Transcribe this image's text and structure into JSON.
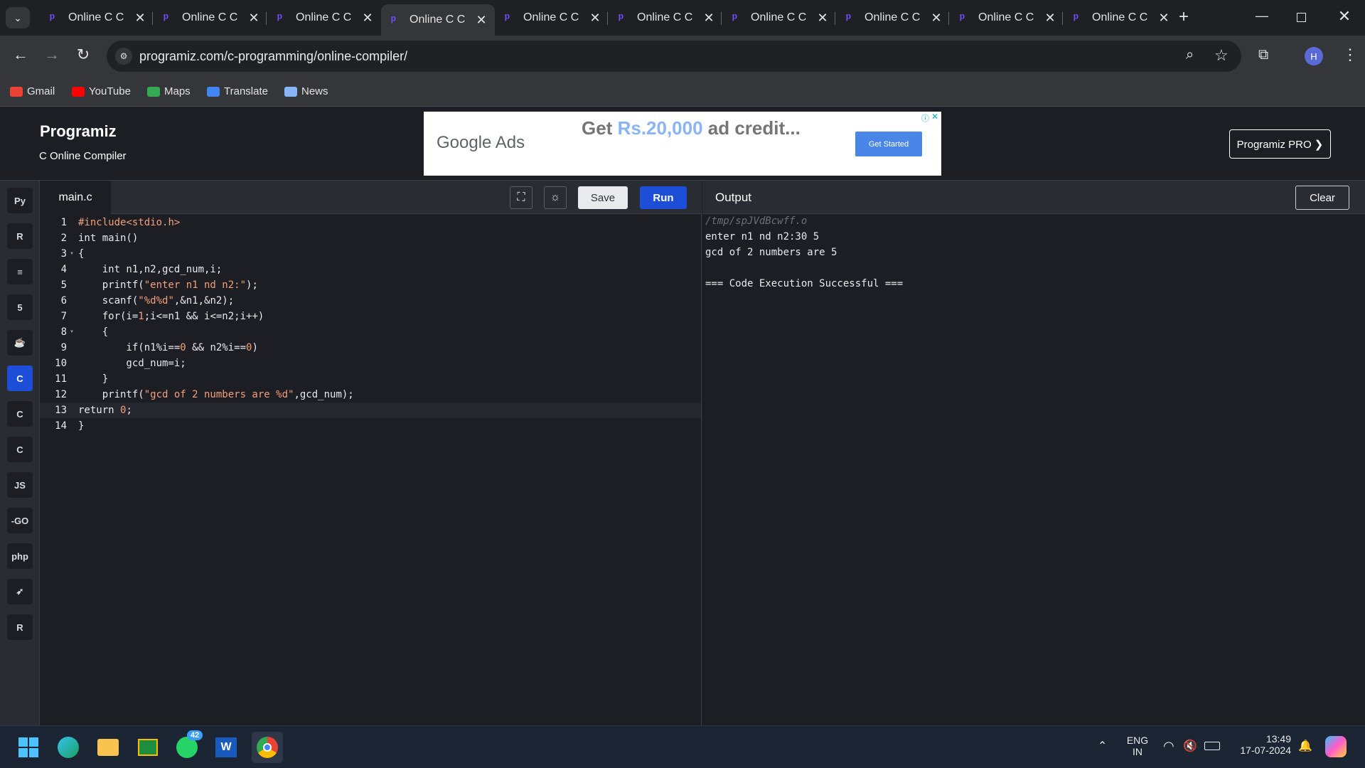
{
  "browser": {
    "tabs": [
      {
        "title": "Online C C",
        "active": false
      },
      {
        "title": "Online C C",
        "active": false
      },
      {
        "title": "Online C C",
        "active": false
      },
      {
        "title": "Online C C",
        "active": true
      },
      {
        "title": "Online C C",
        "active": false
      },
      {
        "title": "Online C C",
        "active": false
      },
      {
        "title": "Online C C",
        "active": false
      },
      {
        "title": "Online C C",
        "active": false
      },
      {
        "title": "Online C C",
        "active": false
      },
      {
        "title": "Online C C",
        "active": false
      }
    ],
    "url": "programiz.com/c-programming/online-compiler/",
    "profile_initial": "H",
    "bookmarks": [
      {
        "label": "Gmail",
        "icon": "gmail-icon",
        "color": "#ea4335"
      },
      {
        "label": "YouTube",
        "icon": "youtube-icon",
        "color": "#ff0000"
      },
      {
        "label": "Maps",
        "icon": "maps-icon",
        "color": "#34a853"
      },
      {
        "label": "Translate",
        "icon": "translate-icon",
        "color": "#4285f4"
      },
      {
        "label": "News",
        "icon": "news-icon",
        "color": "#8ab4f8"
      }
    ]
  },
  "site": {
    "logo": "Programiz",
    "subtitle": "C Online Compiler",
    "ad": {
      "brand": "Google Ads",
      "headline_prefix": "Get ",
      "headline_amount": "Rs.20,000",
      "headline_suffix": " ad credit...",
      "cta": "Get Started"
    },
    "pro_button": "Programiz PRO ❯"
  },
  "rail": {
    "items": [
      {
        "name": "python-icon",
        "glyph": "Py",
        "active": false
      },
      {
        "name": "r-icon",
        "glyph": "R",
        "active": false
      },
      {
        "name": "sql-icon",
        "glyph": "≡",
        "active": false
      },
      {
        "name": "html-icon",
        "glyph": "5",
        "active": false
      },
      {
        "name": "java-icon",
        "glyph": "☕",
        "active": false
      },
      {
        "name": "c-icon",
        "glyph": "C",
        "active": true
      },
      {
        "name": "cpp-icon",
        "glyph": "C",
        "active": false
      },
      {
        "name": "csharp-icon",
        "glyph": "C",
        "active": false
      },
      {
        "name": "js-icon",
        "glyph": "JS",
        "active": false
      },
      {
        "name": "go-icon",
        "glyph": "-GO",
        "active": false
      },
      {
        "name": "php-icon",
        "glyph": "php",
        "active": false
      },
      {
        "name": "swift-icon",
        "glyph": "➶",
        "active": false
      },
      {
        "name": "rust-icon",
        "glyph": "R",
        "active": false
      }
    ]
  },
  "editor": {
    "filename": "main.c",
    "save_label": "Save",
    "run_label": "Run",
    "lines": [
      {
        "n": "1",
        "html": "<span class=\"kw\">#include</span><span class=\"inc\">&lt;stdio.h&gt;</span>",
        "fold": ""
      },
      {
        "n": "2",
        "html": "int main()",
        "fold": ""
      },
      {
        "n": "3",
        "html": "{",
        "fold": "▾"
      },
      {
        "n": "4",
        "html": "    int n1,n2,gcd_num,i;",
        "fold": ""
      },
      {
        "n": "5",
        "html": "    printf(<span class=\"str\">\"enter n1 nd n2:\"</span>);",
        "fold": ""
      },
      {
        "n": "6",
        "html": "    scanf(<span class=\"str\">\"%d%d\"</span>,&amp;n1,&amp;n2);",
        "fold": ""
      },
      {
        "n": "7",
        "html": "    for(i=<span class=\"str\">1</span>;i&lt;=n1 &amp;&amp; i&lt;=n2;i++)",
        "fold": ""
      },
      {
        "n": "8",
        "html": "    {",
        "fold": "▾"
      },
      {
        "n": "9",
        "html": "        if(n1%i==<span class=\"str\">0</span> &amp;&amp; n2%i==<span class=\"str\">0</span>)",
        "fold": ""
      },
      {
        "n": "10",
        "html": "        gcd_num=i;",
        "fold": ""
      },
      {
        "n": "11",
        "html": "    }",
        "fold": ""
      },
      {
        "n": "12",
        "html": "    printf(<span class=\"str\">\"gcd of 2 numbers are %d\"</span>,gcd_num);",
        "fold": ""
      },
      {
        "n": "13",
        "html": "return <span class=\"str\">0</span>;",
        "fold": "",
        "current": true
      },
      {
        "n": "14",
        "html": "}",
        "fold": ""
      }
    ]
  },
  "output": {
    "title": "Output",
    "clear_label": "Clear",
    "lines": [
      {
        "text": "/tmp/spJVdBcwff.o",
        "style": "path"
      },
      {
        "text": "enter n1 nd n2:30 5",
        "style": "normal"
      },
      {
        "text": "gcd of 2 numbers are 5",
        "style": "normal"
      },
      {
        "text": "",
        "style": "normal"
      },
      {
        "text": "=== Code Execution Successful ===",
        "style": "normal"
      }
    ]
  },
  "taskbar": {
    "whatsapp_badge": "42",
    "language": "ENG",
    "region": "IN",
    "time": "13:49",
    "date": "17-07-2024"
  }
}
